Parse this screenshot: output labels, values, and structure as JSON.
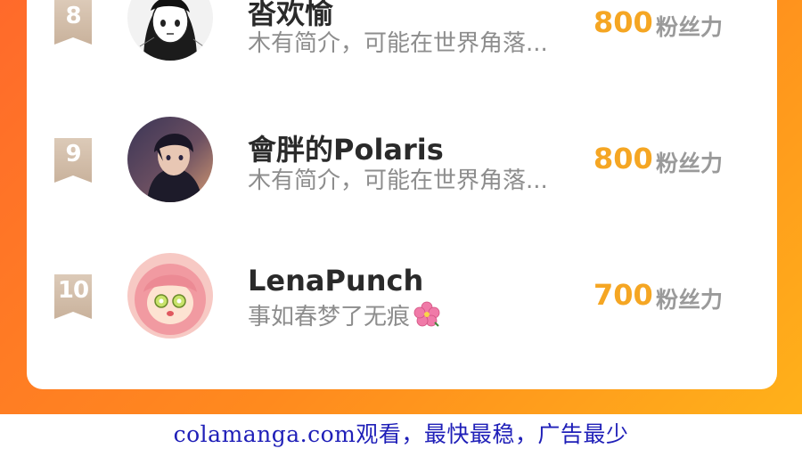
{
  "leaderboard": {
    "rows": [
      {
        "rank": "8",
        "name": "沓欢愉",
        "bio": "木有简介，可能在世界角落...",
        "fans_value": "800",
        "fans_label": "粉丝力",
        "avatar_icon": "manga-girl-avatar"
      },
      {
        "rank": "9",
        "name": "會胖的Polaris",
        "bio": "木有简介，可能在世界角落...",
        "fans_value": "800",
        "fans_label": "粉丝力",
        "avatar_icon": "anime-boy-avatar"
      },
      {
        "rank": "10",
        "name": "LenaPunch",
        "bio": "事如春梦了无痕",
        "fans_value": "700",
        "fans_label": "粉丝力",
        "avatar_icon": "anime-pink-hair-avatar",
        "bio_emoji_icon": "hibiscus-flower-icon"
      }
    ]
  },
  "footer": {
    "watermark": "colamanga.com观看，最快最稳，广告最少"
  },
  "colors": {
    "background_start": "#ff6a2b",
    "background_end": "#ffb11a",
    "fans_value": "#f5a623",
    "watermark": "#1f1fb8"
  }
}
